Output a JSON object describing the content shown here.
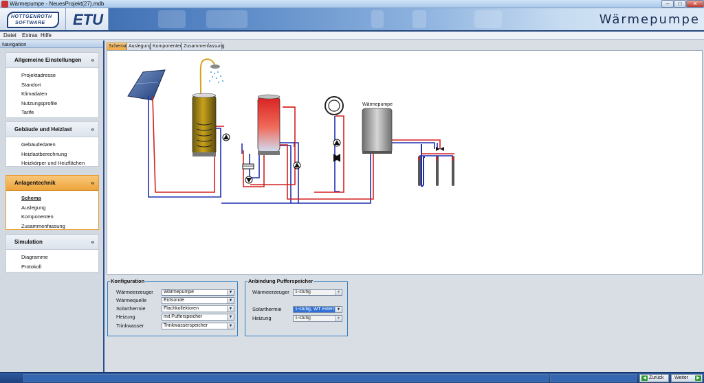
{
  "window": {
    "title": "Wärmepumpe - NeuesProjekt(27).mdb",
    "minimize": "–",
    "maximize": "□",
    "close": "✕"
  },
  "banner": {
    "brand_line1": "HOTTGENROTH",
    "brand_line2": "SOFTWARE",
    "product": "ETU",
    "module": "Wärmepumpe"
  },
  "menu": [
    "Datei",
    "Extras",
    "Hilfe"
  ],
  "navigation": {
    "header": "Navigation",
    "groups": [
      {
        "title": "Allgemeine Einstellungen",
        "items": [
          "Projektadresse",
          "Standort",
          "Klimadaten",
          "Nutzungsprofile",
          "Tarife"
        ]
      },
      {
        "title": "Gebäude und Heizlast",
        "items": [
          "Gebäudedaten",
          "Heizlastberechnung",
          "Heizkörper und Heizflächen"
        ]
      },
      {
        "title": "Anlagentechnik",
        "items": [
          "Schema",
          "Auslegung",
          "Komponenten",
          "Zusammenfassung"
        ],
        "active": true,
        "current": "Schema"
      },
      {
        "title": "Simulation",
        "items": [
          "Diagramme",
          "Protokoll"
        ]
      }
    ],
    "collapse_glyph": "«"
  },
  "tabs": [
    "Schema",
    "Auslegung",
    "Komponenten",
    "Zusammenfassung"
  ],
  "schema": {
    "heatpump_label": "Wärmepumpe",
    "colors": {
      "supply": "#d42020",
      "return": "#1f2fb0",
      "pump": "#111111"
    }
  },
  "konfiguration": {
    "title": "Konfiguration",
    "rows": [
      {
        "label": "Wärmeerzeuger",
        "value": "Wärmepumpe"
      },
      {
        "label": "Wärmequelle",
        "value": "Erdsonde"
      },
      {
        "label": "Solarthermie",
        "value": "Flachkollektoren"
      },
      {
        "label": "Heizung",
        "value": "mit Pufferspeicher"
      },
      {
        "label": "Trinkwasser",
        "value": "Trinkwasserspeicher"
      }
    ]
  },
  "anbindung": {
    "title": "Anbindung Pufferspeicher",
    "rows": [
      {
        "label": "Wärmeerzeuger",
        "value": "1-stufig"
      },
      {
        "label": "Solarthermie",
        "value": "1-stufig, WT extern"
      },
      {
        "label": "Heizung",
        "value": "1-stufig"
      }
    ]
  },
  "footer": {
    "back_label": "Zurück",
    "next_label": "Weiter"
  }
}
